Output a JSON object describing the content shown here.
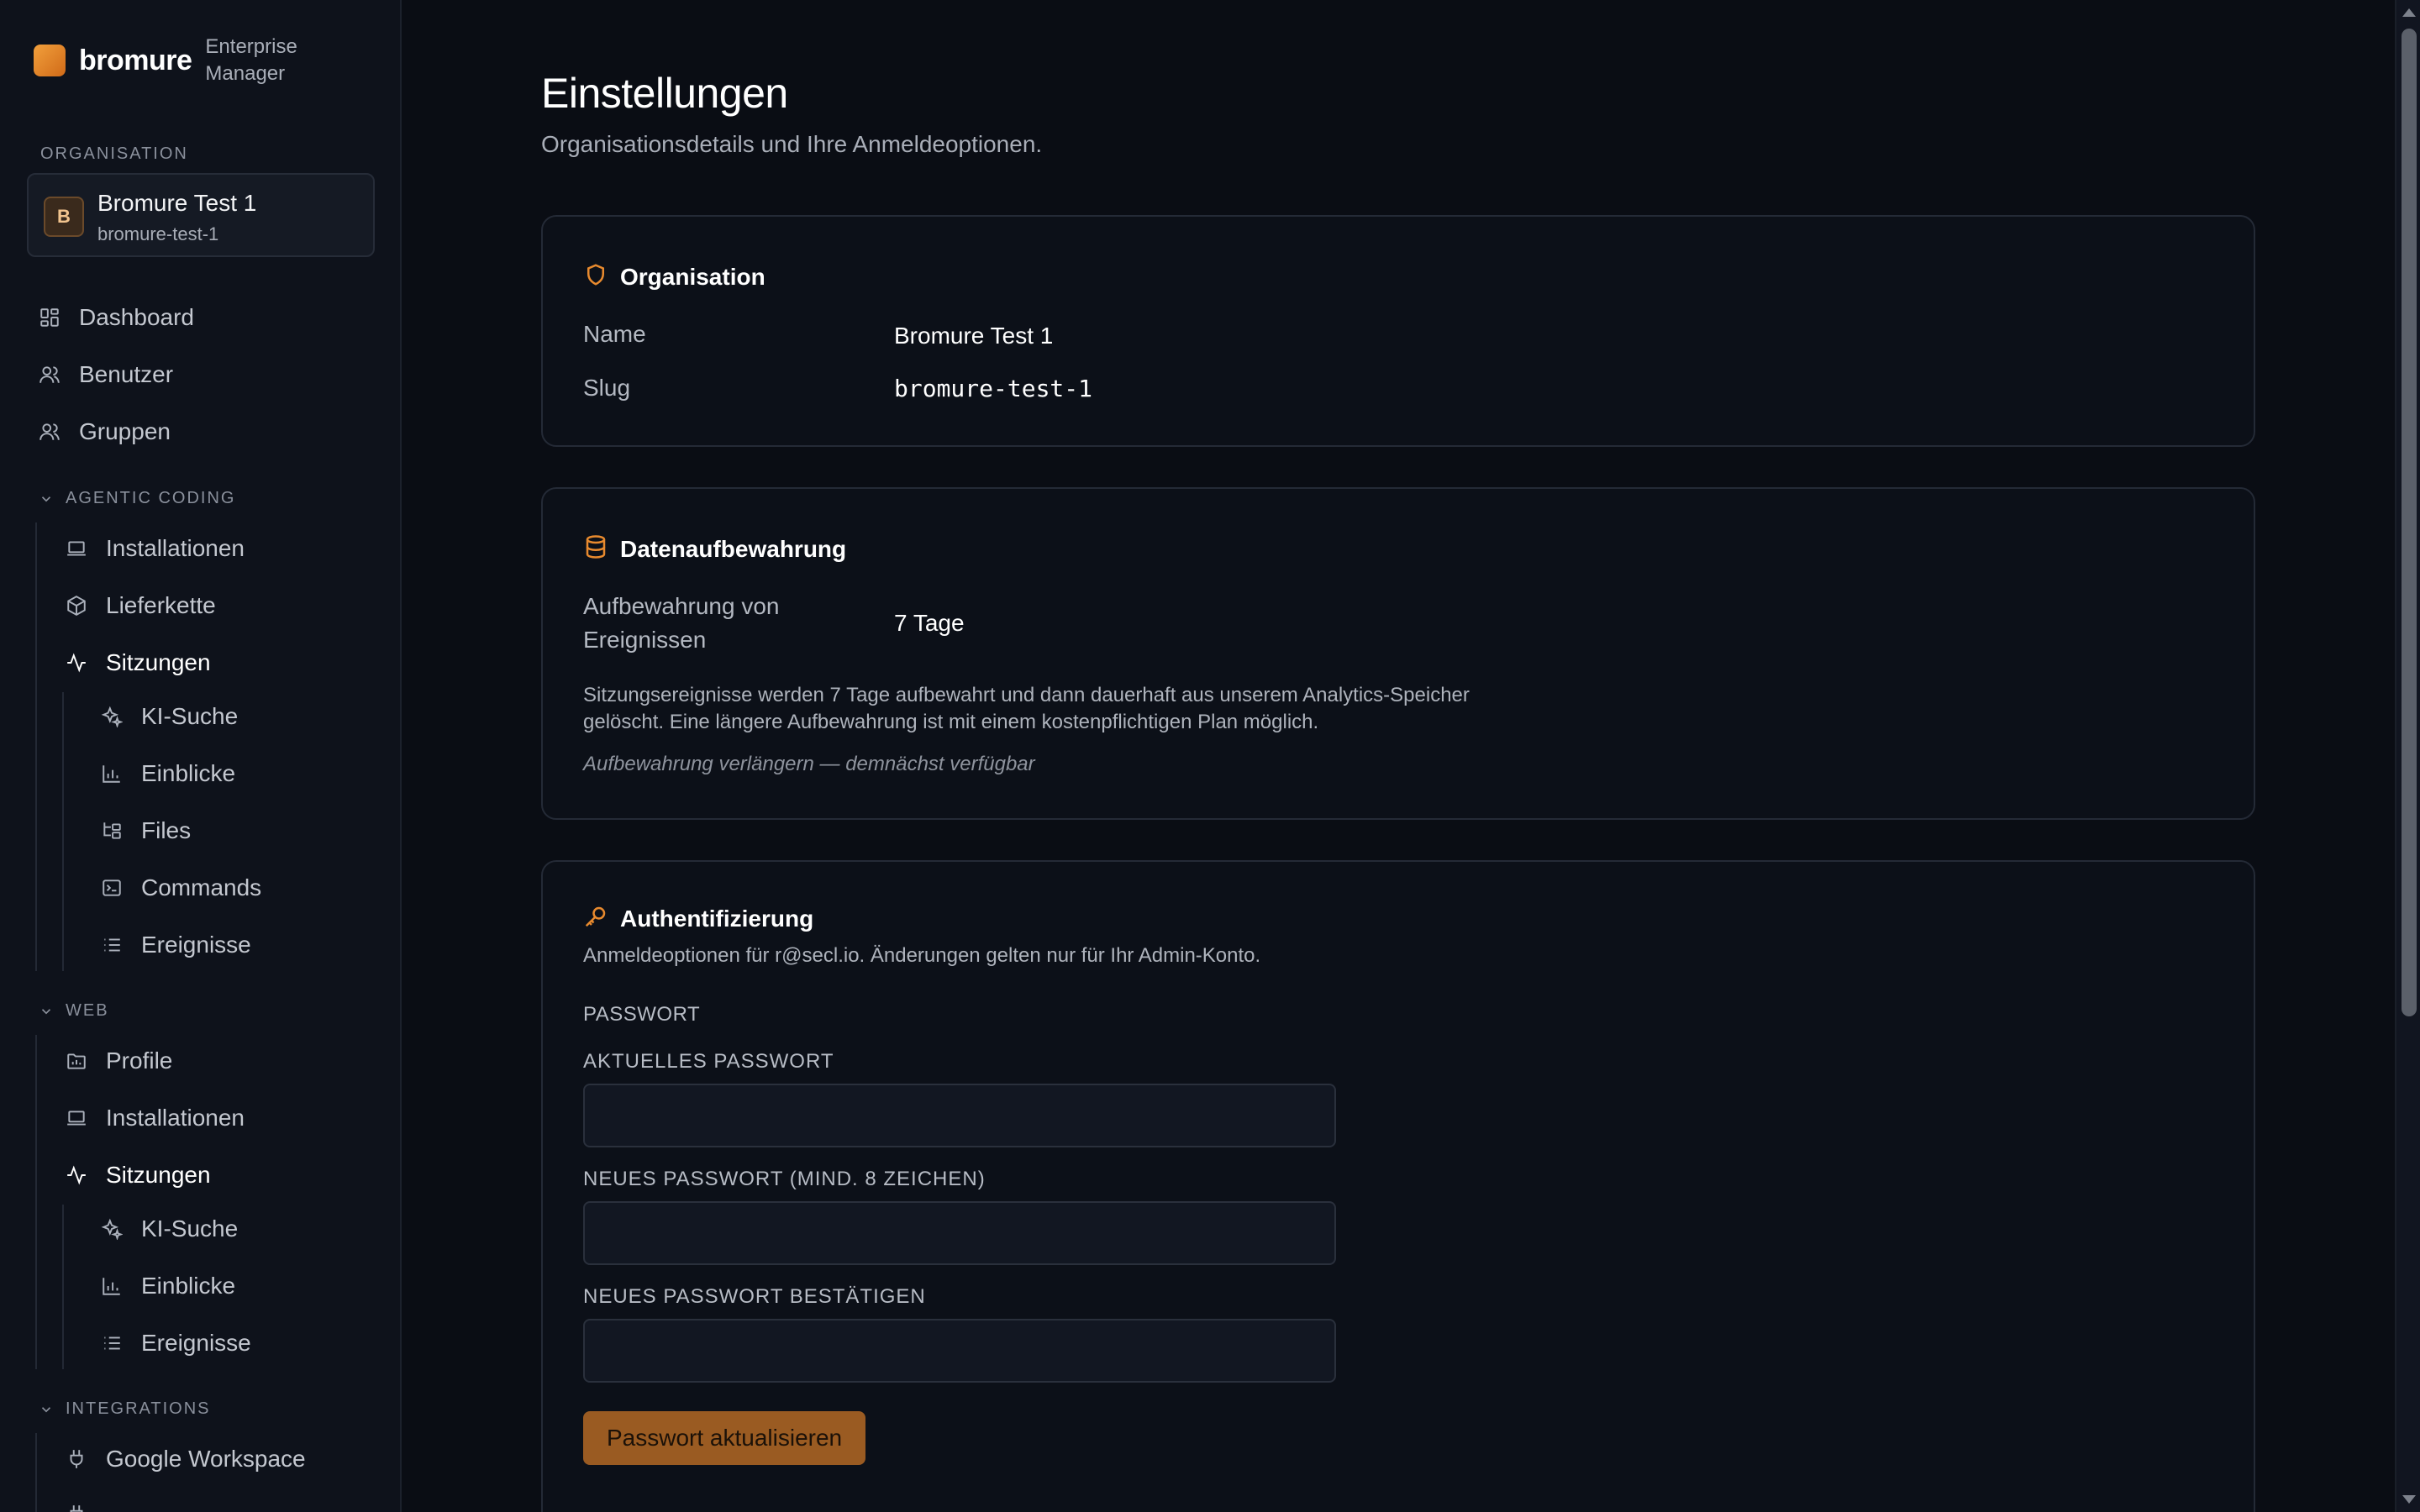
{
  "brand": {
    "name": "bromure",
    "subtitle_line1": "Enterprise",
    "subtitle_line2": "Manager"
  },
  "organisation_section": {
    "label": "ORGANISATION",
    "avatar": "B",
    "name": "Bromure Test 1",
    "slug": "bromure-test-1"
  },
  "nav": {
    "top": [
      {
        "label": "Dashboard",
        "icon": "dashboard-icon"
      },
      {
        "label": "Benutzer",
        "icon": "user-icon"
      },
      {
        "label": "Gruppen",
        "icon": "users-icon"
      }
    ],
    "agentic": {
      "title": "AGENTIC CODING",
      "installationen": "Installationen",
      "lieferkette": "Lieferkette",
      "sitzungen": "Sitzungen",
      "ki_suche": "KI-Suche",
      "einblicke": "Einblicke",
      "files": "Files",
      "commands": "Commands",
      "ereignisse": "Ereignisse"
    },
    "web": {
      "title": "WEB",
      "profile": "Profile",
      "installationen": "Installationen",
      "sitzungen": "Sitzungen",
      "ki_suche": "KI-Suche",
      "einblicke": "Einblicke",
      "ereignisse": "Ereignisse"
    },
    "integrations": {
      "title": "INTEGRATIONS",
      "google": "Google Workspace"
    }
  },
  "page": {
    "title": "Einstellungen",
    "subtitle": "Organisationsdetails und Ihre Anmeldeoptionen."
  },
  "org_card": {
    "title": "Organisation",
    "name_label": "Name",
    "name_value": "Bromure Test 1",
    "slug_label": "Slug",
    "slug_value": "bromure-test-1"
  },
  "retention_card": {
    "title": "Datenaufbewahrung",
    "label_line1": "Aufbewahrung von",
    "label_line2": "Ereignissen",
    "value": "7 Tage",
    "note_line1": "Sitzungsereignisse werden 7 Tage aufbewahrt und dann dauerhaft aus unserem Analytics-Speicher",
    "note_line2": "gelöscht. Eine längere Aufbewahrung ist mit einem kostenpflichtigen Plan möglich.",
    "extend": "Aufbewahrung verlängern — demnächst verfügbar"
  },
  "auth_card": {
    "title": "Authentifizierung",
    "subtitle": "Anmeldeoptionen für r@secl.io. Änderungen gelten nur für Ihr Admin-Konto.",
    "section": "PASSWORT",
    "current_label": "AKTUELLES PASSWORT",
    "current_value": "",
    "new_label": "NEUES PASSWORT (MIND. 8 ZEICHEN)",
    "new_value": "",
    "confirm_label": "NEUES PASSWORT BESTÄTIGEN",
    "confirm_value": "",
    "submit": "Passwort aktualisieren"
  },
  "colors": {
    "accent": "#e88a2e",
    "background": "#0a0d14",
    "sidebar": "#0e121b",
    "button": "#9a5b22"
  }
}
